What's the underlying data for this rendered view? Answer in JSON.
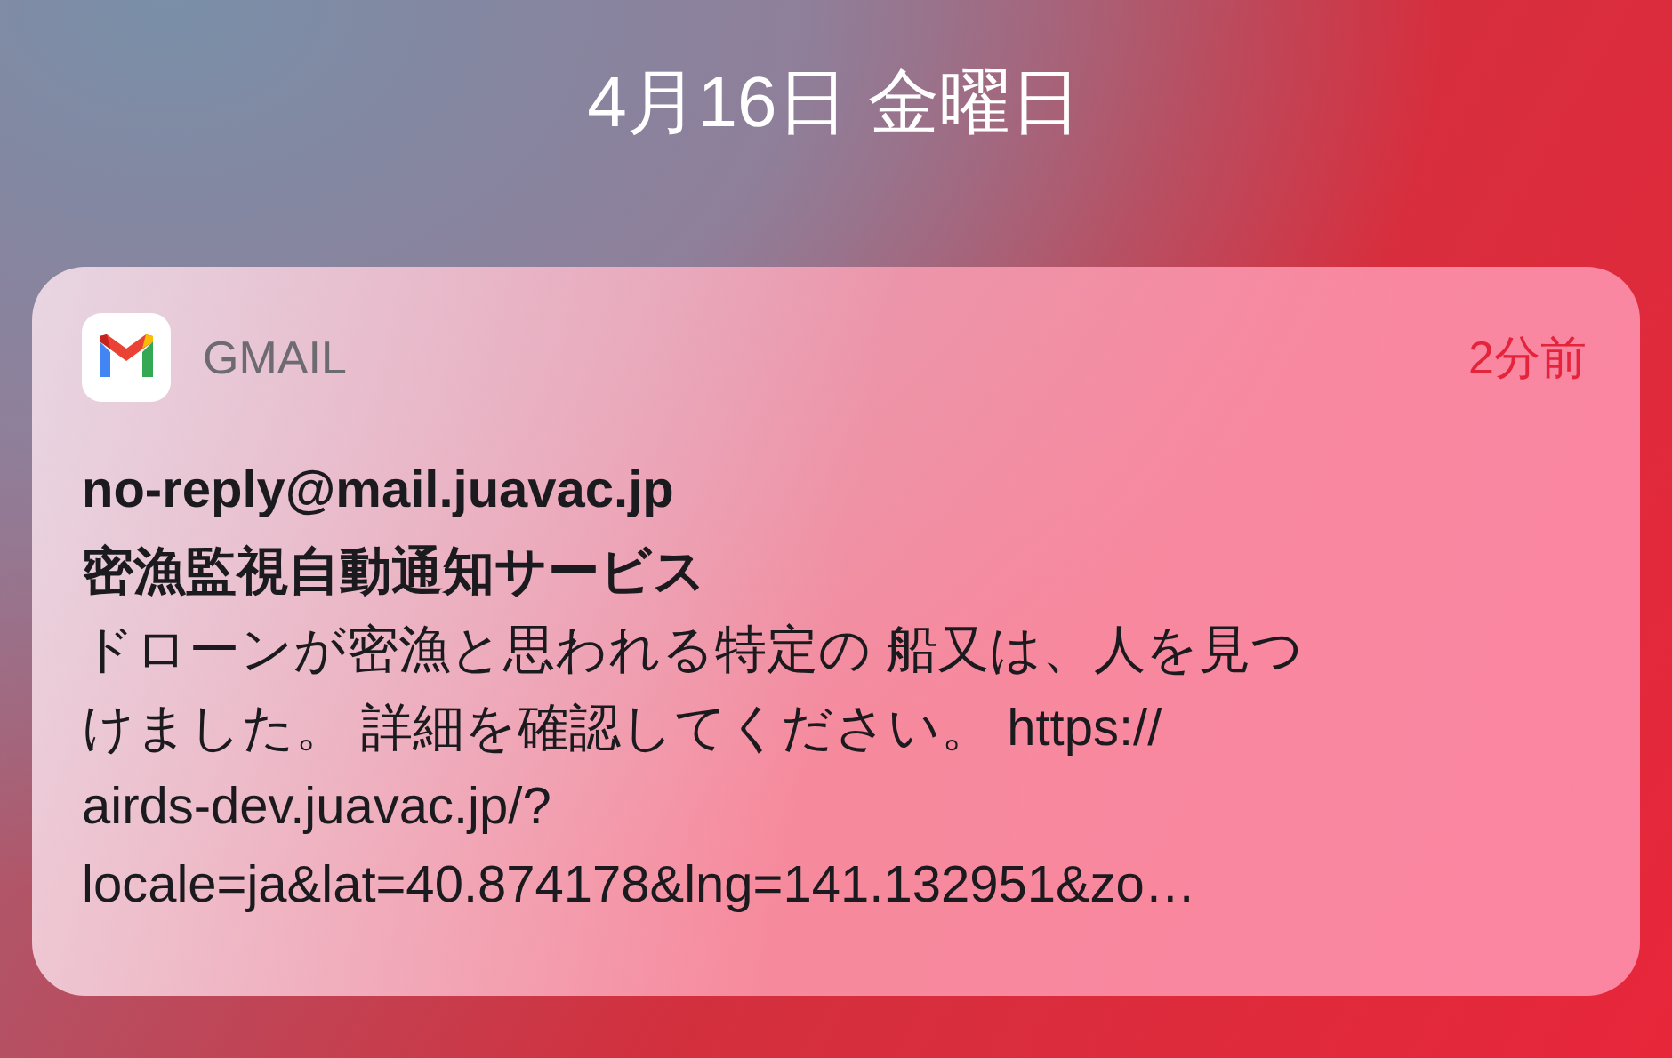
{
  "date": "4月16日 金曜日",
  "notification": {
    "app": "GMAIL",
    "time": "2分前",
    "sender": "no-reply@mail.juavac.jp",
    "title": "密漁監視自動通知サービス",
    "body_lines": [
      "ドローンが密漁と思われる特定の 船又は、人を見つ",
      "けました。 詳細を確認してください。 https://",
      "airds-dev.juavac.jp/?",
      "locale=ja&lat=40.874178&lng=141.132951&zo…"
    ]
  }
}
